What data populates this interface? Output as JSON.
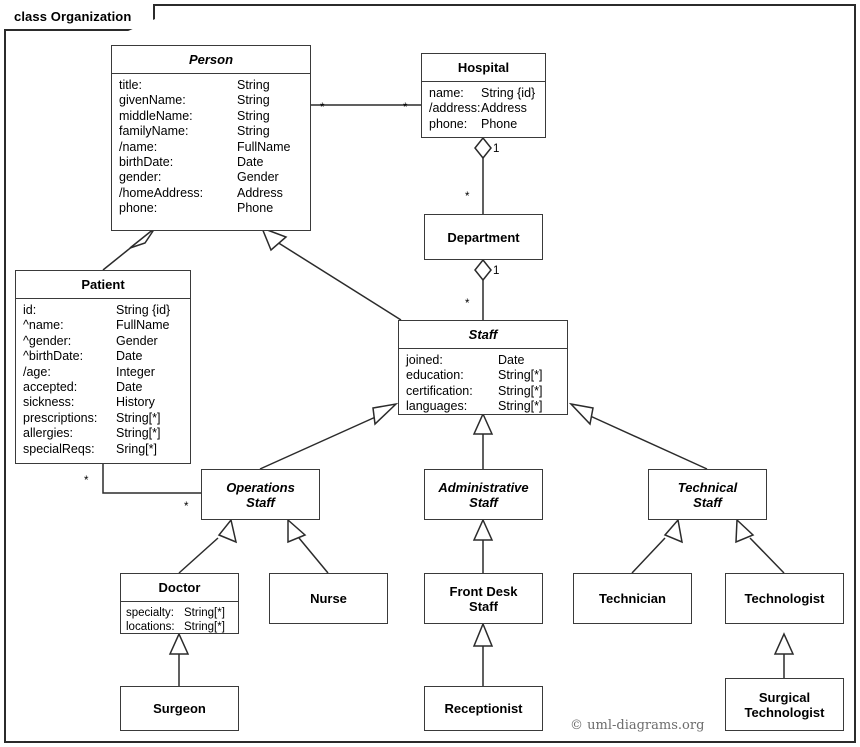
{
  "frame": {
    "label": "class Organization"
  },
  "credit": "© uml-diagrams.org",
  "classes": {
    "person": {
      "name": "Person",
      "abstract": true,
      "attributes": [
        {
          "name": "title:",
          "type": "String"
        },
        {
          "name": "givenName:",
          "type": "String"
        },
        {
          "name": "middleName:",
          "type": "String"
        },
        {
          "name": "familyName:",
          "type": "String"
        },
        {
          "name": "/name:",
          "type": "FullName"
        },
        {
          "name": "birthDate:",
          "type": "Date"
        },
        {
          "name": "gender:",
          "type": "Gender"
        },
        {
          "name": "/homeAddress:",
          "type": "Address"
        },
        {
          "name": "phone:",
          "type": "Phone"
        }
      ]
    },
    "hospital": {
      "name": "Hospital",
      "abstract": false,
      "attributes": [
        {
          "name": "name:",
          "type": "String {id}"
        },
        {
          "name": "/address:",
          "type": "Address"
        },
        {
          "name": "phone:",
          "type": "Phone"
        }
      ]
    },
    "department": {
      "name": "Department",
      "abstract": false,
      "attributes": []
    },
    "patient": {
      "name": "Patient",
      "abstract": false,
      "attributes": [
        {
          "name": "id:",
          "type": "String {id}"
        },
        {
          "name": "^name:",
          "type": "FullName"
        },
        {
          "name": "^gender:",
          "type": "Gender"
        },
        {
          "name": "^birthDate:",
          "type": "Date"
        },
        {
          "name": "/age:",
          "type": "Integer"
        },
        {
          "name": "accepted:",
          "type": "Date"
        },
        {
          "name": "sickness:",
          "type": "History"
        },
        {
          "name": "prescriptions:",
          "type": "String[*]"
        },
        {
          "name": "allergies:",
          "type": "String[*]"
        },
        {
          "name": "specialReqs:",
          "type": "Sring[*]"
        }
      ]
    },
    "staff": {
      "name": "Staff",
      "abstract": true,
      "attributes": [
        {
          "name": "joined:",
          "type": "Date"
        },
        {
          "name": "education:",
          "type": "String[*]"
        },
        {
          "name": "certification:",
          "type": "String[*]"
        },
        {
          "name": "languages:",
          "type": "String[*]"
        }
      ]
    },
    "operations_staff": {
      "name": "Operations\nStaff",
      "abstract": true,
      "attributes": []
    },
    "administrative_staff": {
      "name": "Administrative\nStaff",
      "abstract": true,
      "attributes": []
    },
    "technical_staff": {
      "name": "Technical\nStaff",
      "abstract": true,
      "attributes": []
    },
    "doctor": {
      "name": "Doctor",
      "abstract": false,
      "attributes": [
        {
          "name": "specialty:",
          "type": "String[*]"
        },
        {
          "name": "locations:",
          "type": "String[*]"
        }
      ]
    },
    "nurse": {
      "name": "Nurse",
      "abstract": false,
      "attributes": []
    },
    "front_desk_staff": {
      "name": "Front Desk\nStaff",
      "abstract": false,
      "attributes": []
    },
    "technician": {
      "name": "Technician",
      "abstract": false,
      "attributes": []
    },
    "technologist": {
      "name": "Technologist",
      "abstract": false,
      "attributes": []
    },
    "surgeon": {
      "name": "Surgeon",
      "abstract": false,
      "attributes": []
    },
    "receptionist": {
      "name": "Receptionist",
      "abstract": false,
      "attributes": []
    },
    "surgical_technologist": {
      "name": "Surgical\nTechnologist",
      "abstract": false,
      "attributes": []
    }
  },
  "multiplicities": {
    "person_hospital_person_end": "*",
    "person_hospital_hospital_end": "*",
    "hospital_department_hospital_end": "1",
    "hospital_department_department_end": "*",
    "department_staff_department_end": "1",
    "department_staff_staff_end": "*",
    "patient_operations_patient_end": "*",
    "patient_operations_staff_end": "*"
  }
}
